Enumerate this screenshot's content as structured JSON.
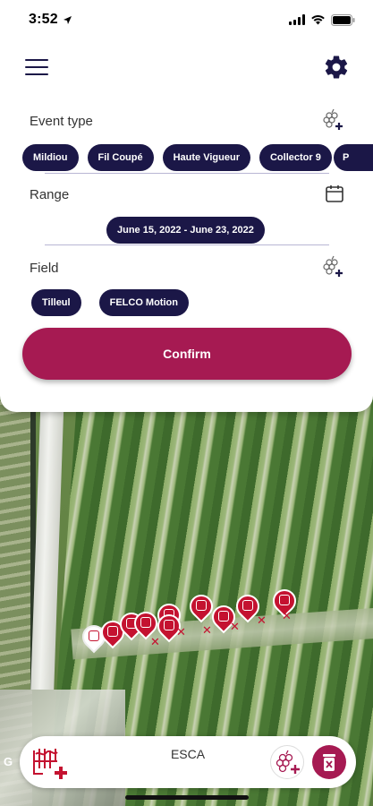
{
  "status_bar": {
    "time": "3:52"
  },
  "filters": {
    "event_type": {
      "label": "Event type",
      "chips": [
        "Mildiou",
        "Fil Coupé",
        "Haute Vigueur",
        "Collector 9",
        "P"
      ]
    },
    "range": {
      "label": "Range",
      "value": "June 15, 2022 - June 23, 2022"
    },
    "field": {
      "label": "Field",
      "chips": [
        "Tilleul",
        "FELCO Motion"
      ]
    },
    "confirm_label": "Confirm"
  },
  "bottom_card": {
    "title": "ESCA"
  },
  "map": {
    "google_label": "G"
  },
  "colors": {
    "primary": "#1b1747",
    "accent": "#a61a52",
    "marker": "#c41230"
  },
  "icons": {
    "menu": "hamburger-menu-icon",
    "settings": "gear-icon",
    "event_add": "grape-add-icon",
    "calendar": "calendar-icon",
    "field_add": "grape-add-icon",
    "logo": "vineyard-logo-icon",
    "grape_button": "grape-add-icon",
    "delete": "trash-icon"
  }
}
